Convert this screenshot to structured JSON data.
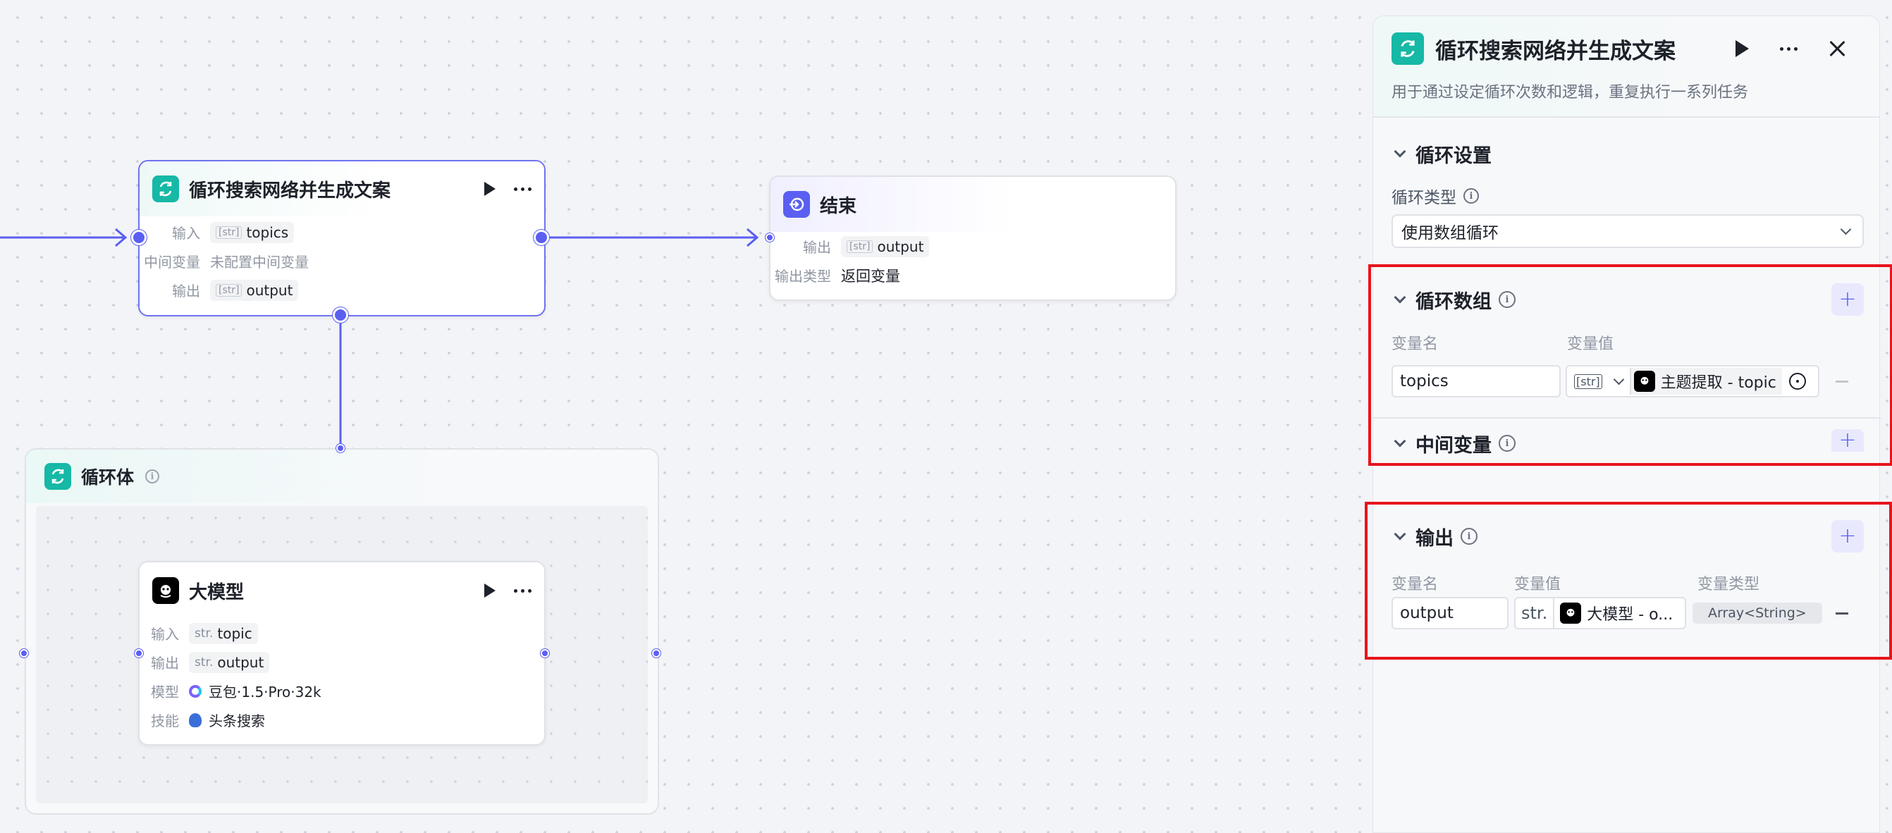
{
  "loop_node": {
    "title": "循环搜索网络并生成文案",
    "input_label": "输入",
    "input_type": "[str]",
    "input_value": "topics",
    "intermediate_label": "中间变量",
    "intermediate_value": "未配置中间变量",
    "output_label": "输出",
    "output_type": "[str]",
    "output_value": "output"
  },
  "end_node": {
    "title": "结束",
    "output_label": "输出",
    "output_type": "[str]",
    "output_value": "output",
    "output_type_label": "输出类型",
    "output_type_value": "返回变量"
  },
  "loop_body": {
    "title": "循环体"
  },
  "llm_node": {
    "title": "大模型",
    "input_label": "输入",
    "input_type": "str.",
    "input_value": "topic",
    "output_label": "输出",
    "output_type": "str.",
    "output_value": "output",
    "model_label": "模型",
    "model_value": "豆包·1.5·Pro·32k",
    "skill_label": "技能",
    "skill_value": "头条搜索"
  },
  "panel": {
    "title": "循环搜索网络并生成文案",
    "description": "用于通过设定循环次数和逻辑，重复执行一系列任务",
    "loop_settings": {
      "title": "循环设置",
      "type_label": "循环类型",
      "type_value": "使用数组循环"
    },
    "loop_array": {
      "title": "循环数组",
      "col_name": "变量名",
      "col_value": "变量值",
      "var_name": "topics",
      "var_type": "[str]",
      "ref_value": "主题提取 - topic"
    },
    "intermediate": {
      "title": "中间变量"
    },
    "output": {
      "title": "输出",
      "col_name": "变量名",
      "col_value": "变量值",
      "col_type": "变量类型",
      "var_name": "output",
      "var_type": "str.",
      "ref_value": "大模型 - o...",
      "type_tag": "Array<String>"
    }
  },
  "colors": {
    "accent": "#5b5ff1",
    "teal": "#16b8a6",
    "highlight": "#e8141b"
  }
}
